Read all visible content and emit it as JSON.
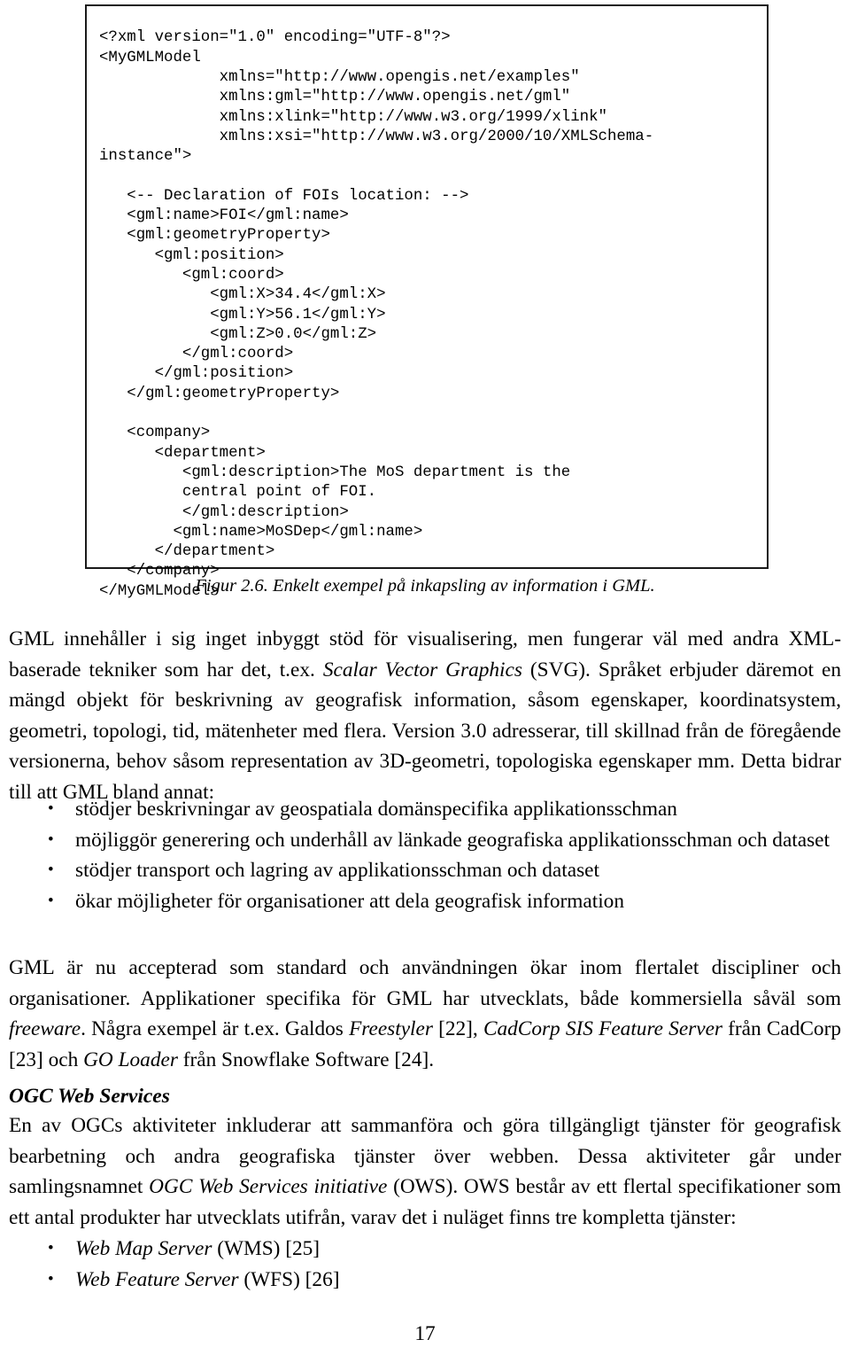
{
  "figure": {
    "code_listing": "<?xml version=\"1.0\" encoding=\"UTF-8\"?>\n<MyGMLModel\n             xmlns=\"http://www.opengis.net/examples\"\n             xmlns:gml=\"http://www.opengis.net/gml\"\n             xmlns:xlink=\"http://www.w3.org/1999/xlink\"\n             xmlns:xsi=\"http://www.w3.org/2000/10/XMLSchema-\ninstance\">\n\n   <-- Declaration of FOIs location: -->\n   <gml:name>FOI</gml:name>\n   <gml:geometryProperty>\n      <gml:position>\n         <gml:coord>\n            <gml:X>34.4</gml:X>\n            <gml:Y>56.1</gml:Y>\n            <gml:Z>0.0</gml:Z>\n         </gml:coord>\n      </gml:position>\n   </gml:geometryProperty>\n\n   <company>\n      <department>\n         <gml:description>The MoS department is the\n         central point of FOI.\n         </gml:description>\n        <gml:name>MoSDep</gml:name>\n      </department>\n   </company>\n</MyGMLModel>",
    "caption": "Figur 2.6. Enkelt exempel på inkapsling av information i GML."
  },
  "body": {
    "para_gml_intro": {
      "seg1": "GML innehåller i sig inget inbyggt stöd för visualisering, men fungerar väl med andra XML-baserade tekniker som har det, t.ex. ",
      "italic1": "Scalar Vector Graphics",
      "seg2": " (SVG). Språket erbjuder däremot en mängd objekt för beskrivning av geografisk information, såsom egenskaper, koordinatsystem, geometri, topologi, tid, mätenheter med flera. Version 3.0 adresserar, till skillnad från de föregående versionerna, behov såsom representation av 3D-geometri, topologiska egenskaper mm. Detta bidrar till att GML bland annat:"
    },
    "bullets_gml": [
      "stödjer beskrivningar av geospatiala domänspecifika applikationsschman",
      "möjliggör generering och underhåll av länkade geografiska applikationsschman och dataset",
      "stödjer transport och lagring av applikationsschman och dataset",
      "ökar möjligheter för organisationer att dela geografisk information"
    ],
    "para_gml_accept": {
      "seg1": "GML är nu accepterad som standard och användningen ökar inom flertalet discipliner och organisationer. Applikationer specifika för GML har utvecklats, både kommersiella såväl som ",
      "italic1": "freeware",
      "seg2": ". Några exempel är t.ex. Galdos ",
      "italic2": "Freestyler",
      "seg3": " [22], ",
      "italic3": "CadCorp SIS Feature Server",
      "seg4": " från CadCorp [23] och ",
      "italic4": "GO Loader",
      "seg5": " från Snowflake Software [24]."
    },
    "heading_ows": "OGC Web Services",
    "para_ows": {
      "seg1": "En av OGCs aktiviteter inkluderar att sammanföra och göra tillgängligt tjänster för geografisk bearbetning och andra geografiska tjänster över webben. Dessa aktiviteter går under samlingsnamnet ",
      "italic1": "OGC Web Services initiative",
      "seg2": " (OWS). OWS består av ett flertal specifikationer som ett antal produkter har utvecklats utifrån, varav det i nuläget finns tre kompletta tjänster:"
    },
    "bullets_ows": [
      {
        "italic": "Web Map Server",
        "rest": " (WMS) [25]"
      },
      {
        "italic": "Web Feature Server",
        "rest": " (WFS) [26]"
      }
    ]
  },
  "footer": {
    "page_number": "17"
  },
  "icons": {
    "bullet": "•"
  }
}
